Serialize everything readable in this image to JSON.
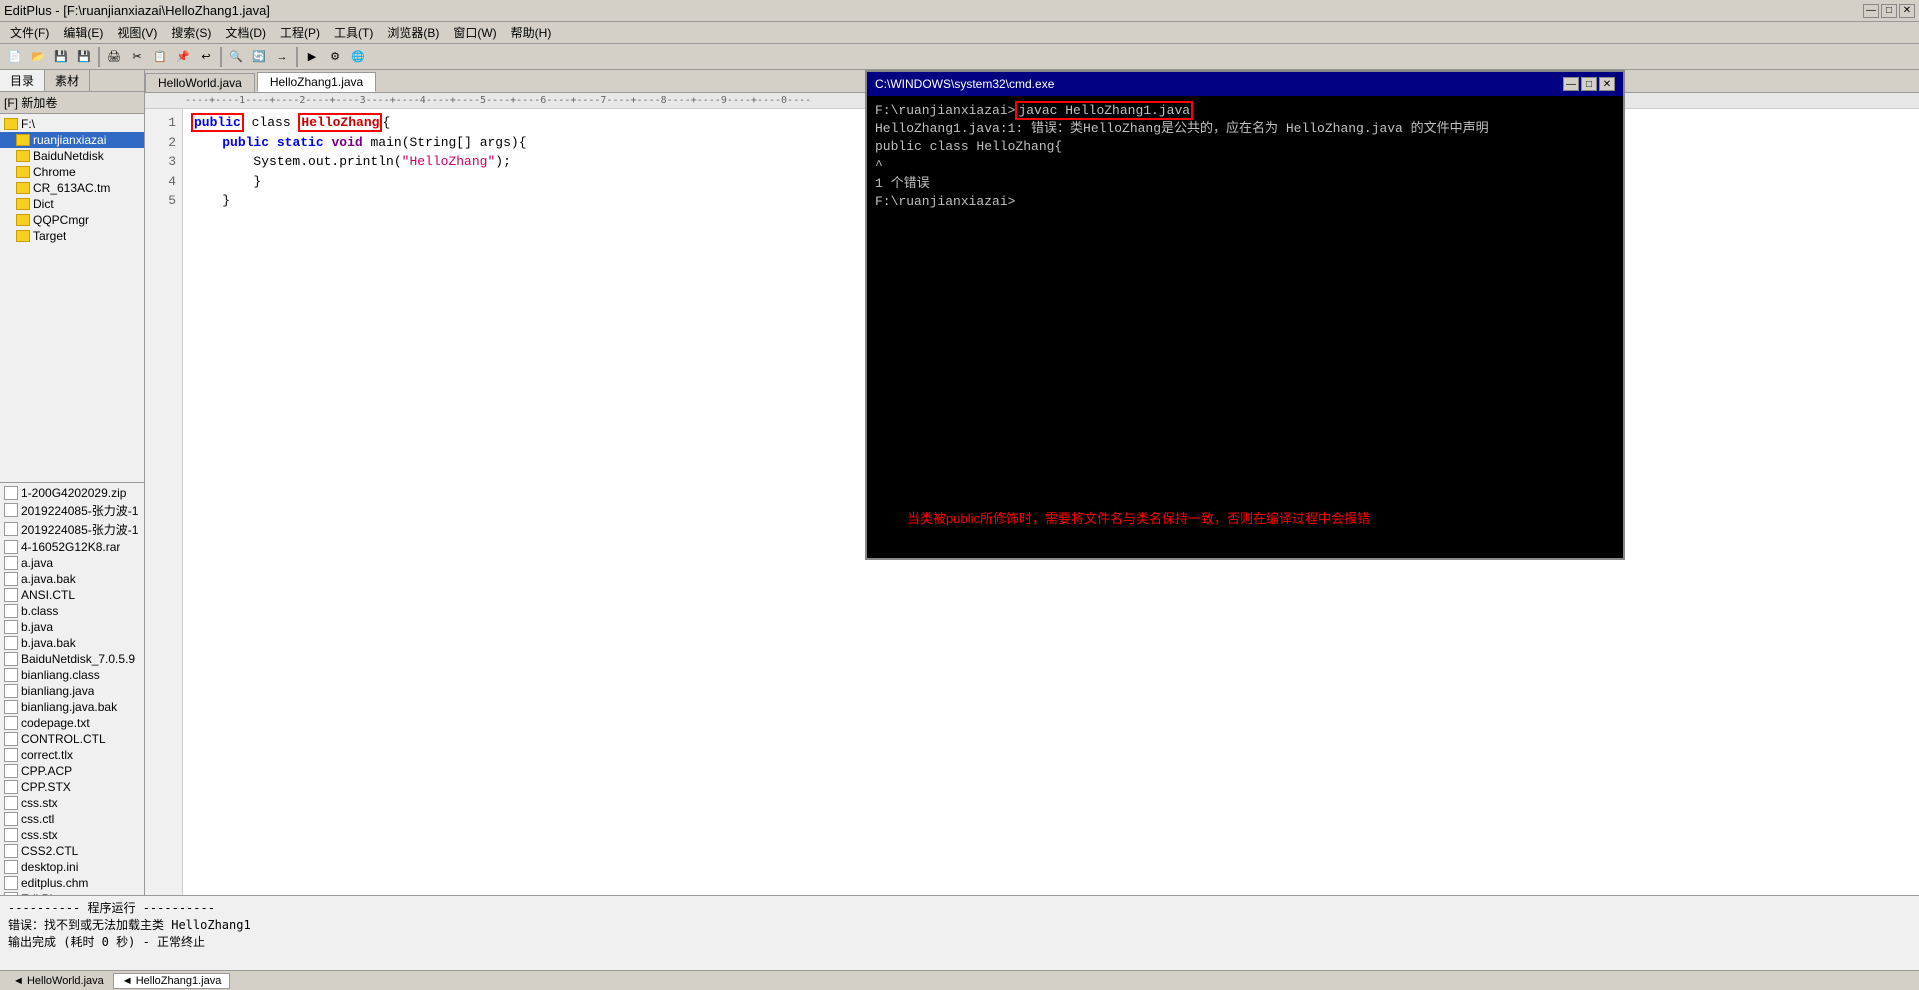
{
  "titleBar": {
    "text": "EditPlus - [F:\\ruanjianxiazai\\HelloZhang1.java]",
    "min": "—",
    "max": "□",
    "close": "✕"
  },
  "menuBar": {
    "items": [
      {
        "label": "文件(F)"
      },
      {
        "label": "编辑(E)"
      },
      {
        "label": "视图(V)"
      },
      {
        "label": "搜索(S)"
      },
      {
        "label": "文档(D)"
      },
      {
        "label": "工程(P)"
      },
      {
        "label": "工具(T)"
      },
      {
        "label": "浏览器(B)"
      },
      {
        "label": "窗口(W)"
      },
      {
        "label": "帮助(H)"
      }
    ]
  },
  "panelTabs": {
    "tabs": [
      "目录",
      "素材"
    ]
  },
  "dirLabel": "[F] 新加卷",
  "fileTree": {
    "items": [
      {
        "type": "folder",
        "name": "F:\\",
        "level": 0
      },
      {
        "type": "folder",
        "name": "ruanjianxiazai",
        "level": 1
      },
      {
        "type": "folder",
        "name": "BaiduNetdisk",
        "level": 1
      },
      {
        "type": "folder",
        "name": "Chrome",
        "level": 1
      },
      {
        "type": "folder",
        "name": "CR_613AC.tm",
        "level": 1
      },
      {
        "type": "folder",
        "name": "Dict",
        "level": 1
      },
      {
        "type": "folder",
        "name": "QQPCmgr",
        "level": 1
      },
      {
        "type": "folder",
        "name": "Target",
        "level": 1
      }
    ]
  },
  "fileList": {
    "items": [
      "1-200G4202029.zip",
      "2019224085-张力波-1",
      "2019224085-张力波-1",
      "4-16052G12K8.rar",
      "a.java",
      "a.java.bak",
      "ANSI.CTL",
      "b.class",
      "b.java",
      "b.java.bak",
      "BaiduNetdisk_7.0.5.9",
      "bianliang.class",
      "bianliang.java",
      "bianliang.java.bak",
      "codepage.txt",
      "CONTROL.CTL",
      "correct.tlx",
      "CPP.ACP",
      "CPP.STX",
      "css.stx",
      "css.ctl",
      "css.stx",
      "CSS2.CTL",
      "desktop.ini",
      "editplus.chm",
      "EditPlus.exe"
    ]
  },
  "editorTabs": {
    "tabs": [
      "HelloWorld.java",
      "HelloZhang1.java"
    ]
  },
  "ruler": "----+----1----+----2----+----3----+----4----+----5----+----6----+----7----+----8----+----9----+----0----",
  "codeLines": [
    {
      "num": "1",
      "content": "public_class_HelloZhang_open"
    },
    {
      "num": "2",
      "content": "    public_static_void_main_open"
    },
    {
      "num": "3",
      "content": "        System_println_HelloZhang"
    },
    {
      "num": "4",
      "content": "        close_brace"
    },
    {
      "num": "5",
      "content": "    close_brace"
    }
  ],
  "statusBar": {
    "lines": [
      "----------  程序运行  ----------",
      "错误：找不到或无法加载主类 HelloZhang1",
      "",
      "输出完成 (耗时 0 秒) - 正常终止"
    ]
  },
  "bottomTabs": [
    "◄ HelloWorld.java",
    "◄ HelloZhang1.java"
  ],
  "cmdWindow": {
    "title": "C:\\WINDOWS\\system32\\cmd.exe",
    "titleControls": {
      "min": "—",
      "max": "□",
      "close": "✕"
    },
    "lines": [
      "F:\\ruanjianxiazai>javac HelloZhang1.java",
      "HelloZhang1.java:1: 错误：类HelloZhang是公共的，应在名为 HelloZhang.java 的文件中声明",
      "public class HelloZhang{",
      "^",
      "",
      "1 个错误",
      "",
      "F:\\ruanjianxiazai>"
    ],
    "annotation": "当类被public所修饰时，需要将文件名与类名保持一致，否则在编译过程中会报错",
    "highlightCommand": "javac HelloZhang1.java"
  }
}
